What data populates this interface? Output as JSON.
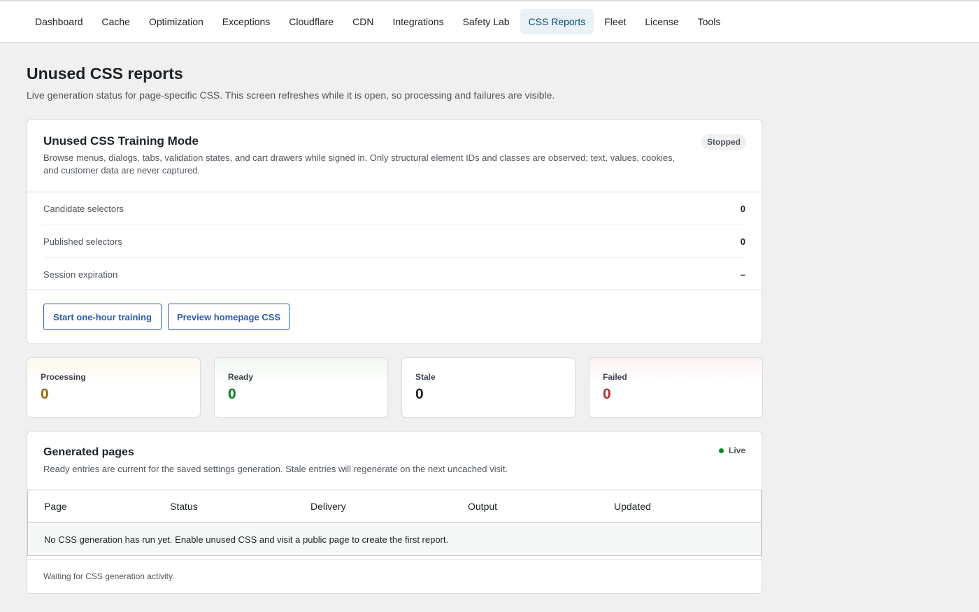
{
  "nav": {
    "items": [
      {
        "label": "Dashboard",
        "active": false
      },
      {
        "label": "Cache",
        "active": false
      },
      {
        "label": "Optimization",
        "active": false
      },
      {
        "label": "Exceptions",
        "active": false
      },
      {
        "label": "Cloudflare",
        "active": false
      },
      {
        "label": "CDN",
        "active": false
      },
      {
        "label": "Integrations",
        "active": false
      },
      {
        "label": "Safety Lab",
        "active": false
      },
      {
        "label": "CSS Reports",
        "active": true
      },
      {
        "label": "Fleet",
        "active": false
      },
      {
        "label": "License",
        "active": false
      },
      {
        "label": "Tools",
        "active": false
      }
    ]
  },
  "page": {
    "title": "Unused CSS reports",
    "description": "Live generation status for page-specific CSS. This screen refreshes while it is open, so processing and failures are visible."
  },
  "training": {
    "title": "Unused CSS Training Mode",
    "description": "Browse menus, dialogs, tabs, validation states, and cart drawers while signed in. Only structural element IDs and classes are observed; text, values, cookies, and customer data are never captured.",
    "status": "Stopped",
    "rows": [
      {
        "label": "Candidate selectors",
        "value": "0"
      },
      {
        "label": "Published selectors",
        "value": "0"
      },
      {
        "label": "Session expiration",
        "value": "–"
      }
    ],
    "start_button": "Start one-hour training",
    "preview_button": "Preview homepage CSS"
  },
  "stats": {
    "processing": {
      "label": "Processing",
      "value": "0",
      "color": "#996800"
    },
    "ready": {
      "label": "Ready",
      "value": "0",
      "color": "#00801c"
    },
    "stale": {
      "label": "Stale",
      "value": "0",
      "color": "#1d2327"
    },
    "failed": {
      "label": "Failed",
      "value": "0",
      "color": "#b32d2e"
    }
  },
  "generated": {
    "title": "Generated pages",
    "description": "Ready entries are current for the saved settings generation. Stale entries will regenerate on the next uncached visit.",
    "live_label": "Live",
    "columns": [
      "Page",
      "Status",
      "Delivery",
      "Output",
      "Updated"
    ],
    "empty_message": "No CSS generation has run yet. Enable unused CSS and visit a public page to create the first report.",
    "footer": "Waiting for CSS generation activity."
  }
}
